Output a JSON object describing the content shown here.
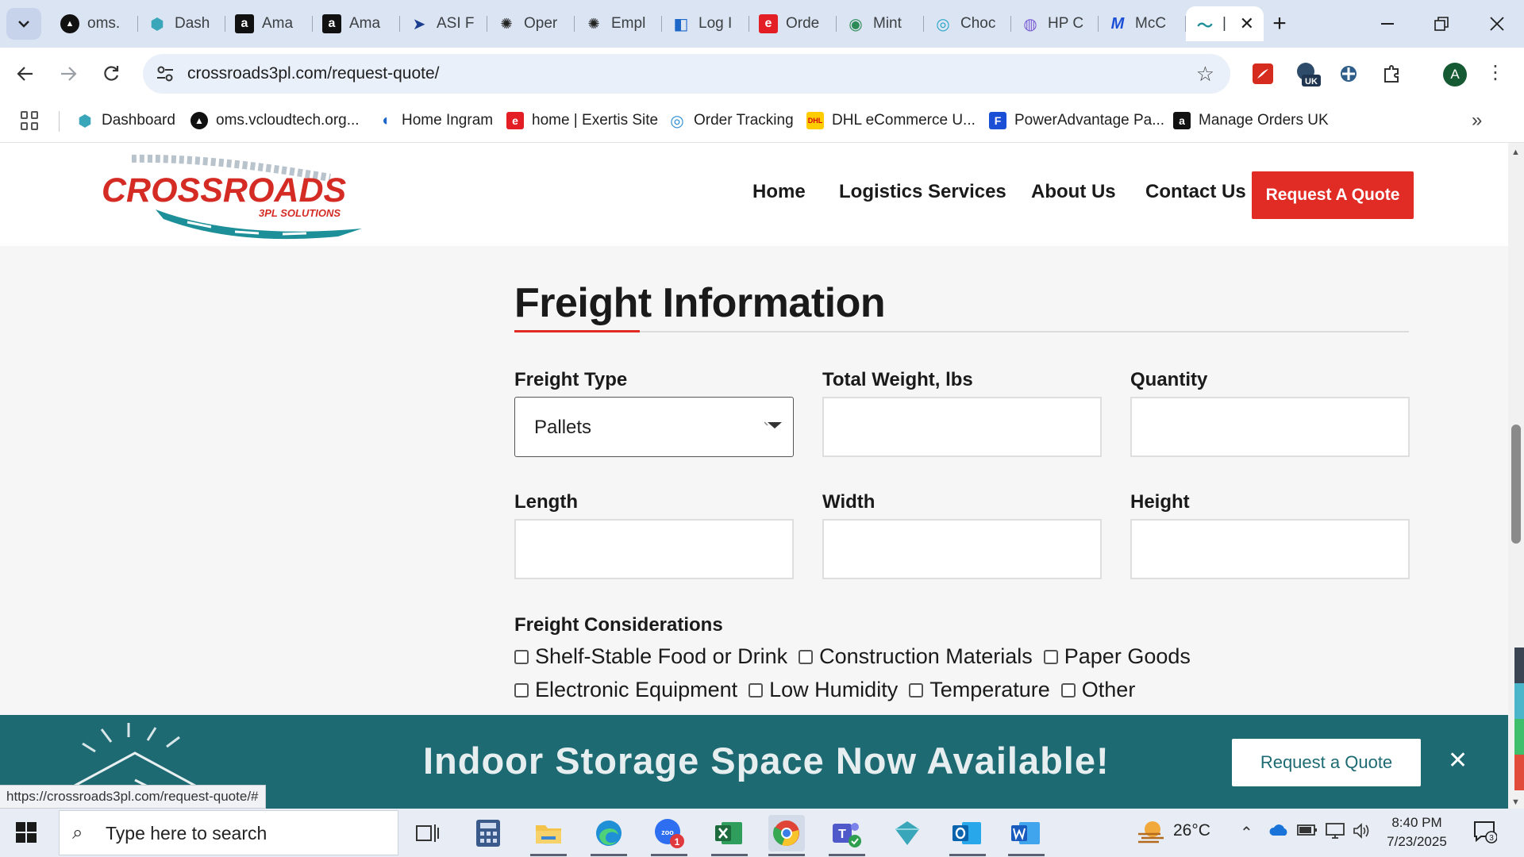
{
  "browser": {
    "tabs": [
      {
        "title": "oms.",
        "icon": "oms-icon"
      },
      {
        "title": "Dash",
        "icon": "dashboard-icon"
      },
      {
        "title": "Ama",
        "icon": "amazon-icon"
      },
      {
        "title": "Ama",
        "icon": "amazon-icon"
      },
      {
        "title": "ASI F",
        "icon": "asi-icon"
      },
      {
        "title": "Oper",
        "icon": "openai-icon"
      },
      {
        "title": "Empl",
        "icon": "openai-icon"
      },
      {
        "title": "Log I",
        "icon": "login-icon"
      },
      {
        "title": "Orde",
        "icon": "exertis-icon"
      },
      {
        "title": "Mint",
        "icon": "mint-icon"
      },
      {
        "title": "Choc",
        "icon": "choc-icon"
      },
      {
        "title": "HP C",
        "icon": "hp-icon"
      },
      {
        "title": "McC",
        "icon": "mcc-icon"
      },
      {
        "title": "|",
        "icon": "crossroads-icon",
        "active": true
      }
    ],
    "url": "crossroads3pl.com/request-quote/",
    "avatar_letter": "A",
    "ext_badge": "UK",
    "bookmarks": [
      {
        "label": "Dashboard"
      },
      {
        "label": "oms.vcloudtech.org..."
      },
      {
        "label": "Home Ingram"
      },
      {
        "label": "home | Exertis Site"
      },
      {
        "label": "Order Tracking"
      },
      {
        "label": "DHL eCommerce U..."
      },
      {
        "label": "PowerAdvantage Pa..."
      },
      {
        "label": "Manage Orders UK"
      }
    ],
    "status_url": "https://crossroads3pl.com/request-quote/#"
  },
  "site": {
    "logo_text": "CROSSROADS",
    "logo_sub": "3PL SOLUTIONS",
    "nav": {
      "home": "Home",
      "logistics": "Logistics Services",
      "about": "About Us",
      "contact": "Contact Us",
      "quote_button": "Request A Quote"
    },
    "form": {
      "section_title": "Freight Information",
      "freight_type_label": "Freight Type",
      "freight_type_value": "Pallets",
      "weight_label": "Total Weight, lbs",
      "quantity_label": "Quantity",
      "length_label": "Length",
      "width_label": "Width",
      "height_label": "Height",
      "considerations_label": "Freight Considerations",
      "considerations": [
        "Shelf-Stable Food or Drink",
        "Construction Materials",
        "Paper Goods",
        "Electronic Equipment",
        "Low Humidity",
        "Temperature",
        "Other"
      ]
    },
    "banner": {
      "text": "Indoor Storage Space Now Available!",
      "button": "Request a Quote",
      "close": "✕"
    }
  },
  "taskbar": {
    "search_placeholder": "Type here to search",
    "weather": "26°C",
    "time": "8:40 PM",
    "date": "7/23/2025",
    "teams_badge": "1",
    "notif_count": "3"
  },
  "colors": {
    "brand_red": "#e12b25",
    "banner_teal": "#1e6a73",
    "tabstrip": "#dbe4f3"
  }
}
